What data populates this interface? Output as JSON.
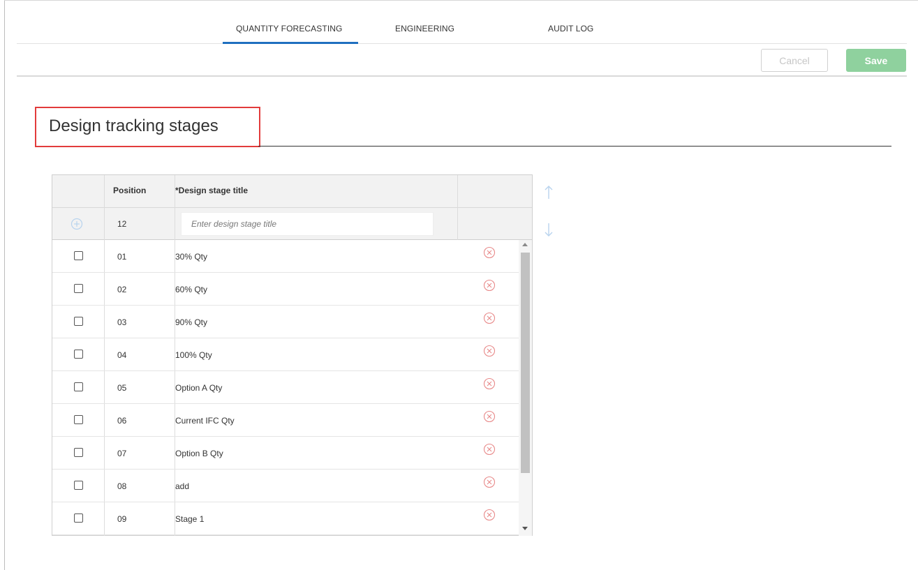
{
  "tabs": [
    {
      "label": "QUANTITY FORECASTING",
      "active": true
    },
    {
      "label": "ENGINEERING",
      "active": false
    },
    {
      "label": "AUDIT LOG",
      "active": false
    }
  ],
  "toolbar": {
    "cancel_label": "Cancel",
    "save_label": "Save"
  },
  "page_title": "Design tracking stages",
  "table": {
    "columns": {
      "position": "Position",
      "title": "*Design stage title"
    },
    "new_row": {
      "position": "12",
      "placeholder": "Enter design stage title",
      "value": ""
    },
    "rows": [
      {
        "position": "01",
        "title": "30% Qty"
      },
      {
        "position": "02",
        "title": "60% Qty"
      },
      {
        "position": "03",
        "title": "90% Qty"
      },
      {
        "position": "04",
        "title": "100% Qty"
      },
      {
        "position": "05",
        "title": "Option A Qty"
      },
      {
        "position": "06",
        "title": "Current IFC Qty"
      },
      {
        "position": "07",
        "title": "Option B Qty"
      },
      {
        "position": "08",
        "title": "add"
      },
      {
        "position": "09",
        "title": "Stage 1"
      }
    ]
  },
  "colors": {
    "accent": "#1f6fbf",
    "save": "#8fd19e",
    "delete": "#e88a8a",
    "highlight": "#e23b3b",
    "move_arrows": "#b8d3ee"
  }
}
